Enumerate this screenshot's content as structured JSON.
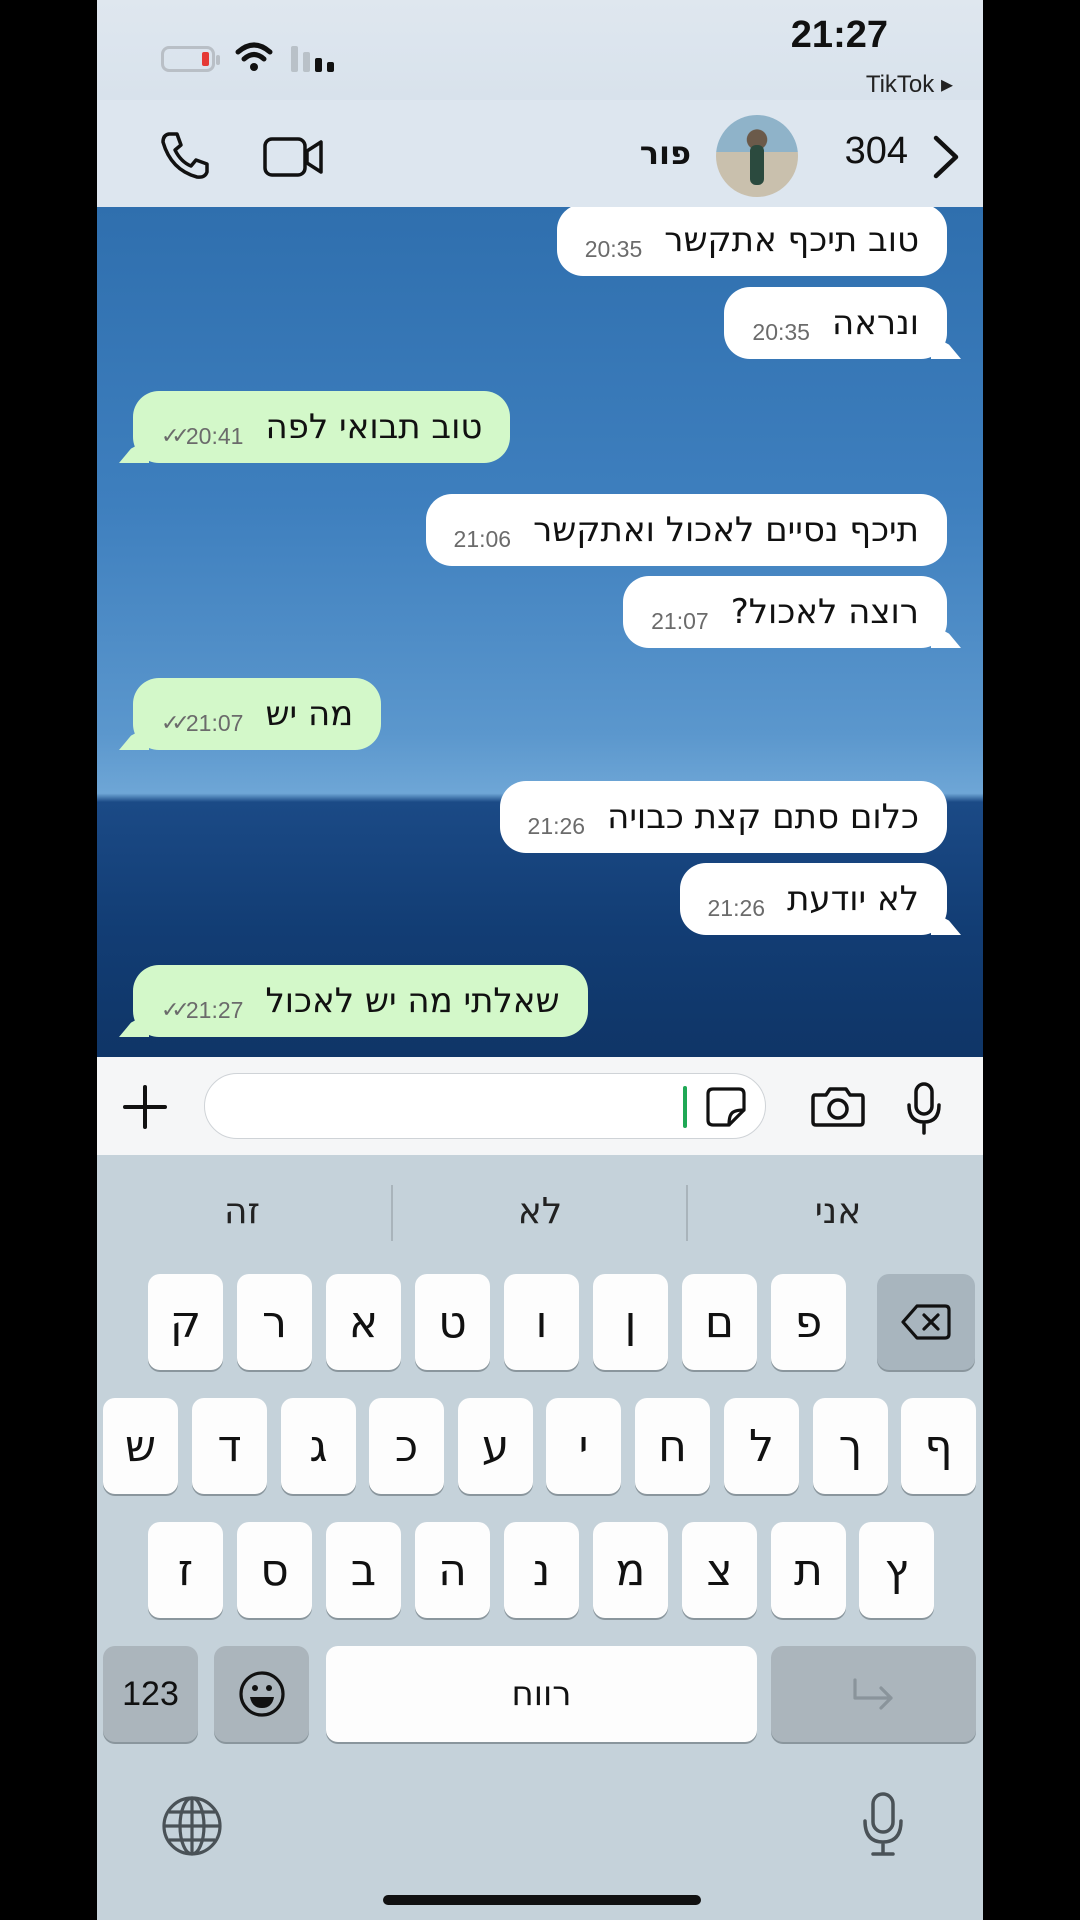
{
  "status_bar": {
    "time": "21:27",
    "back_app": "TikTok ▸"
  },
  "header": {
    "contact_name": "פור",
    "unread_count": "304"
  },
  "messages": [
    {
      "dir": "in",
      "text": "טוב תיכף אתקשר",
      "time": "20:35"
    },
    {
      "dir": "in",
      "text": "ונראה",
      "time": "20:35"
    },
    {
      "dir": "out",
      "text": "טוב תבואי לפה",
      "time": "20:41",
      "ticks": "✓✓"
    },
    {
      "dir": "in",
      "text": "תיכף נסיים לאכול ואתקשר",
      "time": "21:06"
    },
    {
      "dir": "in",
      "text": "רוצה לאכול?",
      "time": "21:07"
    },
    {
      "dir": "out",
      "text": "מה יש",
      "time": "21:07",
      "ticks": "✓✓"
    },
    {
      "dir": "in",
      "text": "כלום סתם קצת כבויה",
      "time": "21:26"
    },
    {
      "dir": "in",
      "text": "לא יודעת",
      "time": "21:26"
    },
    {
      "dir": "out",
      "text": "שאלתי מה יש לאכול",
      "time": "21:27",
      "ticks": "✓✓"
    }
  ],
  "input": {
    "value": ""
  },
  "keyboard": {
    "suggestions": [
      "אני",
      "לא",
      "זה"
    ],
    "row1": [
      "פ",
      "ם",
      "ן",
      "ו",
      "ט",
      "א",
      "ר",
      "ק"
    ],
    "row2": [
      "ף",
      "ך",
      "ל",
      "ח",
      "י",
      "ע",
      "כ",
      "ג",
      "ד",
      "ש"
    ],
    "row3": [
      "ץ",
      "ת",
      "צ",
      "מ",
      "נ",
      "ה",
      "ב",
      "ס",
      "ז"
    ],
    "numbers_label": "123",
    "space_label": "רווח"
  },
  "colors": {
    "outgoing_bubble": "#d3f8c9",
    "incoming_bubble": "#ffffff",
    "cursor": "#1fa855",
    "battery_low": "#e53935"
  }
}
